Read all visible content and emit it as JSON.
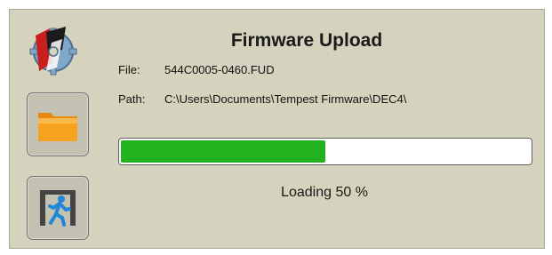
{
  "dialog": {
    "title": "Firmware Upload",
    "file_label": "File:",
    "file_value": "544C0005-0460.FUD",
    "path_label": "Path:",
    "path_value": "C:\\Users\\Documents\\Tempest Firmware\\DEC4\\"
  },
  "progress": {
    "value_fraction": 0.5,
    "fill_color": "#22b11f",
    "status_prefix": "Loading",
    "status_value": "50",
    "status_unit": "%"
  },
  "buttons": {
    "browse_icon": "folder-icon",
    "exit_icon": "exit-running-man-icon"
  },
  "logo_icon": "app-logo-gear-icon",
  "colors": {
    "panel_background": "#d5d3bd",
    "button_background": "#c3c1b2",
    "folder_color": "#f6a21e",
    "exit_figure_color": "#1f86d8"
  }
}
